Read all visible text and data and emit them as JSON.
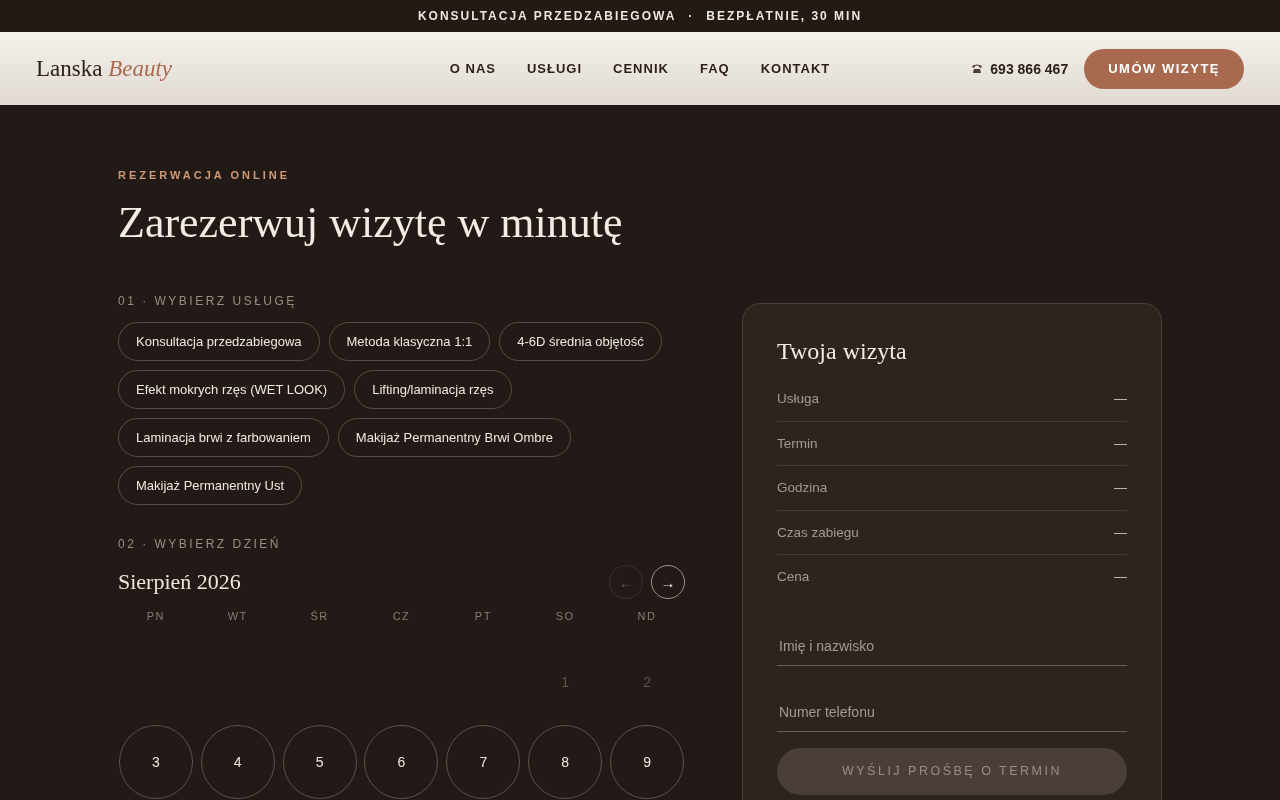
{
  "announcement": {
    "text": "KONSULTACJA PRZEDZABIEGOWA",
    "separator": "·",
    "detail": "BEZPŁATNIE, 30 MIN"
  },
  "header": {
    "logo": {
      "name": "Lanska",
      "accent": "Beauty"
    },
    "nav": [
      {
        "label": "O NAS"
      },
      {
        "label": "USŁUGI"
      },
      {
        "label": "CENNIK"
      },
      {
        "label": "FAQ"
      },
      {
        "label": "KONTAKT"
      }
    ],
    "phone": "693 866 467",
    "cta": "UMÓW WIZYTĘ"
  },
  "booking": {
    "eyebrow": "REZERWACJA ONLINE",
    "title": "Zarezerwuj wizytę w minutę",
    "step1": "01 · WYBIERZ USŁUGĘ",
    "services": [
      {
        "label": "Konsultacja przedzabiegowa",
        "selected": false
      },
      {
        "label": "Metoda klasyczna 1:1",
        "selected": false
      },
      {
        "label": "4-6D średnia objętość",
        "selected": false
      },
      {
        "label": "Efekt mokrych rzęs (WET LOOK)",
        "selected": false
      },
      {
        "label": "Lifting/laminacja rzęs",
        "selected": false
      },
      {
        "label": "Laminacja brwi z farbowaniem",
        "selected": false
      },
      {
        "label": "Makijaż Permanentny Brwi Ombre",
        "selected": false
      },
      {
        "label": "Makijaż Permanentny Ust",
        "selected": false
      }
    ],
    "step2": "02 · WYBIERZ DZIEŃ",
    "calendar": {
      "month": "Sierpień 2026",
      "prev": {
        "label": "←",
        "disabled": true
      },
      "next": {
        "label": "→",
        "disabled": false
      },
      "weekdays": [
        "PN",
        "WT",
        "ŚR",
        "CZ",
        "PT",
        "SO",
        "ND"
      ],
      "weeks": [
        [
          {
            "kind": "blank"
          },
          {
            "kind": "blank"
          },
          {
            "kind": "blank"
          },
          {
            "kind": "blank"
          },
          {
            "kind": "blank"
          },
          {
            "kind": "day",
            "day": "1",
            "available": false
          },
          {
            "kind": "day",
            "day": "2",
            "available": false
          }
        ],
        [
          {
            "kind": "day",
            "day": "3",
            "available": true
          },
          {
            "kind": "day",
            "day": "4",
            "available": true
          },
          {
            "kind": "day",
            "day": "5",
            "available": true
          },
          {
            "kind": "day",
            "day": "6",
            "available": true
          },
          {
            "kind": "day",
            "day": "7",
            "available": true
          },
          {
            "kind": "day",
            "day": "8",
            "available": true
          },
          {
            "kind": "day",
            "day": "9",
            "available": true
          }
        ]
      ]
    }
  },
  "summary": {
    "title": "Twoja wizyta",
    "rows": [
      {
        "label": "Usługa",
        "value": "—"
      },
      {
        "label": "Termin",
        "value": "—"
      },
      {
        "label": "Godzina",
        "value": "—"
      },
      {
        "label": "Czas zabiegu",
        "value": "—"
      },
      {
        "label": "Cena",
        "value": "—"
      }
    ],
    "fields": [
      {
        "placeholder": "Imię i nazwisko"
      },
      {
        "placeholder": "Numer telefonu"
      }
    ],
    "submit": {
      "label": "WYŚLIJ PROŚBĘ O TERMIN",
      "disabled": true
    }
  }
}
